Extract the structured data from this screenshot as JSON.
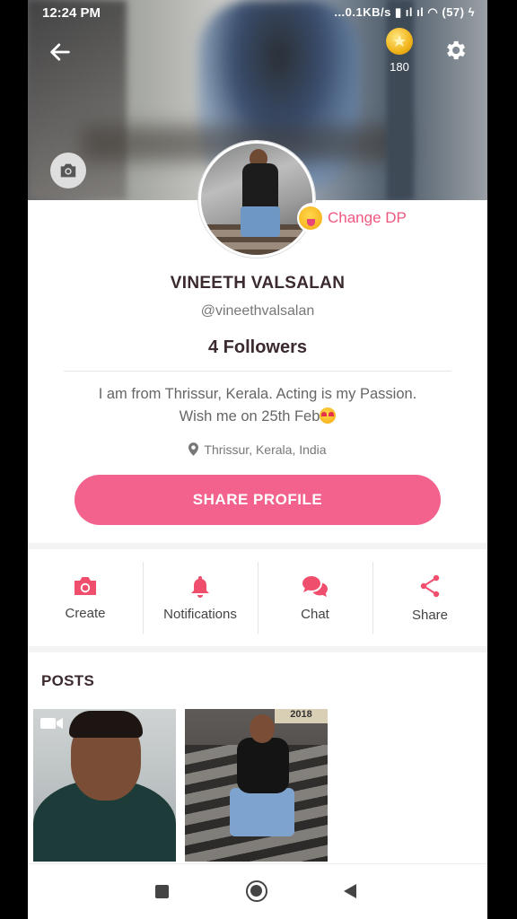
{
  "status_bar": {
    "time": "12:24 PM",
    "network": "...0.1KB/s",
    "battery": "57"
  },
  "header": {
    "coins": "180"
  },
  "profile": {
    "change_dp_label": "Change DP",
    "name": "VINEETH VALSALAN",
    "handle": "@vineethvalsalan",
    "followers": "4 Followers",
    "bio_line1": "I am from Thrissur, Kerala. Acting is my Passion.",
    "bio_line2": "Wish me on 25th Feb",
    "location": "Thrissur, Kerala, India",
    "share_button": "SHARE PROFILE"
  },
  "actions": [
    {
      "label": "Create",
      "icon": "camera-icon"
    },
    {
      "label": "Notifications",
      "icon": "bell-icon"
    },
    {
      "label": "Chat",
      "icon": "chat-icon"
    },
    {
      "label": "Share",
      "icon": "share-icon"
    }
  ],
  "posts": {
    "title": "POSTS",
    "items": [
      {
        "type": "video"
      },
      {
        "type": "photo",
        "sign_text": "2018"
      }
    ]
  },
  "colors": {
    "accent": "#f2628c",
    "icon_accent": "#ef4f6c",
    "text_dark": "#3b2a2e"
  }
}
